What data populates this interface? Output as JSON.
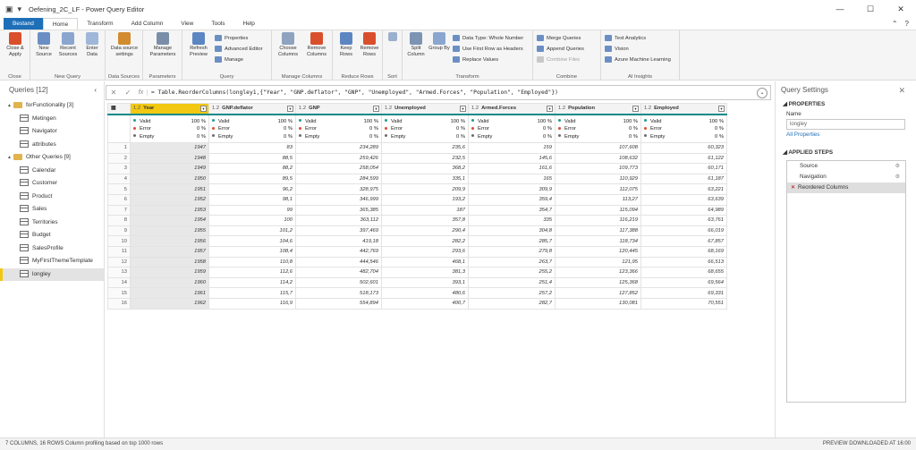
{
  "window": {
    "title": "Oefening_2C_LF - Power Query Editor",
    "controls": [
      "—",
      "☐",
      "✕"
    ]
  },
  "tabs": [
    {
      "label": "Bestand"
    },
    {
      "label": "Home"
    },
    {
      "label": "Transform"
    },
    {
      "label": "Add Column"
    },
    {
      "label": "View"
    },
    {
      "label": "Tools"
    },
    {
      "label": "Help"
    }
  ],
  "ribbon": {
    "close": {
      "btn": "Close & Apply",
      "group": "Close"
    },
    "new_query": {
      "new_source": "New Source",
      "recent_sources": "Recent Sources",
      "enter_data": "Enter Data",
      "group": "New Query"
    },
    "data_sources": {
      "btn": "Data source settings",
      "group": "Data Sources"
    },
    "parameters": {
      "btn": "Manage Parameters",
      "group": "Parameters"
    },
    "query": {
      "refresh": "Refresh Preview",
      "properties": "Properties",
      "advanced_editor": "Advanced Editor",
      "manage": "Manage",
      "group": "Query"
    },
    "manage_columns": {
      "choose": "Choose Columns",
      "remove": "Remove Columns",
      "group": "Manage Columns"
    },
    "reduce_rows": {
      "keep": "Keep Rows",
      "remove": "Remove Rows",
      "group": "Reduce Rows"
    },
    "sort": {
      "group": "Sort"
    },
    "transform": {
      "split": "Split Column",
      "group_by": "Group By",
      "data_type": "Data Type: Whole Number",
      "first_row": "Use First Row as Headers",
      "replace": "Replace Values",
      "group": "Transform"
    },
    "combine": {
      "merge": "Merge Queries",
      "append": "Append Queries",
      "combine_files": "Combine Files",
      "group": "Combine"
    },
    "ai": {
      "text_analytics": "Text Analytics",
      "vision": "Vision",
      "azure_ml": "Azure Machine Learning",
      "group": "AI Insights"
    }
  },
  "queries_panel": {
    "title": "Queries [12]",
    "groups": [
      {
        "name": "forFunctionality [3]",
        "items": [
          "Metingen",
          "Navigator",
          "attributes"
        ]
      },
      {
        "name": "Other Queries [9]",
        "items": [
          "Calendar",
          "Customer",
          "Product",
          "Sales",
          "Territories",
          "Budget",
          "SalesProfile",
          "MyFirstThemeTemplate",
          "longley"
        ]
      }
    ],
    "selected": "longley"
  },
  "formula": {
    "text": "= Table.ReorderColumns(longley1,{\"Year\", \"GNP.deflator\", \"GNP\", \"Unemployed\", \"Armed.Forces\", \"Population\", \"Employed\"})"
  },
  "grid": {
    "columns": [
      {
        "type": "1.2",
        "name": "Year"
      },
      {
        "type": "1.2",
        "name": "GNP.deflator"
      },
      {
        "type": "1.2",
        "name": "GNP"
      },
      {
        "type": "1.2",
        "name": "Unemployed"
      },
      {
        "type": "1.2",
        "name": "Armed.Forces"
      },
      {
        "type": "1.2",
        "name": "Population"
      },
      {
        "type": "1.2",
        "name": "Employed"
      }
    ],
    "profile": {
      "valid_label": "Valid",
      "valid_pct": "100 %",
      "error_label": "Error",
      "error_pct": "0 %",
      "empty_label": "Empty",
      "empty_pct": "0 %"
    },
    "rows": [
      [
        "1",
        "1947",
        "83",
        "234,289",
        "235,6",
        "159",
        "107,608",
        "60,323"
      ],
      [
        "2",
        "1948",
        "88,5",
        "259,426",
        "232,5",
        "145,6",
        "108,632",
        "61,122"
      ],
      [
        "3",
        "1949",
        "88,2",
        "258,054",
        "368,2",
        "161,6",
        "109,773",
        "60,171"
      ],
      [
        "4",
        "1950",
        "89,5",
        "284,599",
        "335,1",
        "165",
        "110,929",
        "61,187"
      ],
      [
        "5",
        "1951",
        "96,2",
        "328,975",
        "209,9",
        "309,9",
        "112,075",
        "63,221"
      ],
      [
        "6",
        "1952",
        "98,1",
        "346,999",
        "193,2",
        "359,4",
        "113,27",
        "63,639"
      ],
      [
        "7",
        "1953",
        "99",
        "365,385",
        "187",
        "354,7",
        "115,094",
        "64,989"
      ],
      [
        "8",
        "1954",
        "100",
        "363,112",
        "357,8",
        "335",
        "116,219",
        "63,761"
      ],
      [
        "9",
        "1955",
        "101,2",
        "397,469",
        "290,4",
        "304,8",
        "117,388",
        "66,019"
      ],
      [
        "10",
        "1956",
        "104,6",
        "419,18",
        "282,2",
        "285,7",
        "118,734",
        "67,857"
      ],
      [
        "11",
        "1957",
        "108,4",
        "442,769",
        "293,6",
        "279,8",
        "120,445",
        "68,169"
      ],
      [
        "12",
        "1958",
        "110,8",
        "444,546",
        "468,1",
        "263,7",
        "121,95",
        "66,513"
      ],
      [
        "13",
        "1959",
        "112,6",
        "482,704",
        "381,3",
        "255,2",
        "123,366",
        "68,655"
      ],
      [
        "14",
        "1960",
        "114,2",
        "502,601",
        "393,1",
        "251,4",
        "125,368",
        "69,564"
      ],
      [
        "15",
        "1961",
        "115,7",
        "518,173",
        "480,6",
        "257,2",
        "127,852",
        "69,331"
      ],
      [
        "16",
        "1962",
        "116,9",
        "554,894",
        "400,7",
        "282,7",
        "130,081",
        "70,551"
      ]
    ]
  },
  "settings": {
    "title": "Query Settings",
    "properties_label": "PROPERTIES",
    "name_label": "Name",
    "name_value": "longley",
    "all_properties": "All Properties",
    "applied_steps_label": "APPLIED STEPS",
    "steps": [
      "Source",
      "Navigation",
      "Reordered Columns"
    ]
  },
  "status": {
    "left": "7 COLUMNS, 16 ROWS     Column profiling based on top 1000 rows",
    "right": "PREVIEW DOWNLOADED AT 16:00"
  },
  "colors": {
    "accent_yellow": "#f2c811",
    "valid": "#1e9e8c",
    "error": "#d94f2b",
    "empty": "#6b6b6b",
    "file_tab": "#1e6fb8"
  }
}
